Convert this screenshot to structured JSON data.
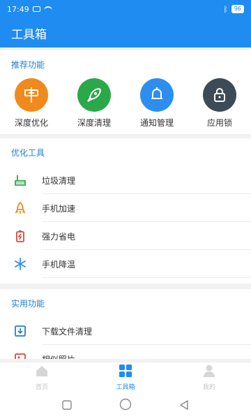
{
  "status": {
    "time": "17:49",
    "battery": "96"
  },
  "appbar": {
    "title": "工具箱"
  },
  "recommend": {
    "title": "推荐功能",
    "items": [
      {
        "label": "深度优化",
        "icon": "signpost-icon",
        "color": "#f08a1c"
      },
      {
        "label": "深度清理",
        "icon": "rocket-icon",
        "color": "#2ba84a"
      },
      {
        "label": "通知管理",
        "icon": "bell-icon",
        "color": "#2d8ef0"
      },
      {
        "label": "应用锁",
        "icon": "lock-icon",
        "color": "#3d4a57"
      }
    ]
  },
  "optimize": {
    "title": "优化工具",
    "items": [
      {
        "label": "垃圾清理",
        "icon": "broom-icon"
      },
      {
        "label": "手机加速",
        "icon": "rocket-icon"
      },
      {
        "label": "强力省电",
        "icon": "battery-icon"
      },
      {
        "label": "手机降温",
        "icon": "snowflake-icon"
      }
    ]
  },
  "utility": {
    "title": "实用功能",
    "items": [
      {
        "label": "下载文件清理",
        "icon": "download-icon"
      },
      {
        "label": "相似照片",
        "icon": "photo-icon"
      }
    ]
  },
  "tabbar": {
    "items": [
      {
        "label": "首页",
        "icon": "home-icon"
      },
      {
        "label": "工具箱",
        "icon": "grid-icon"
      },
      {
        "label": "我的",
        "icon": "person-icon"
      }
    ],
    "active_index": 1
  }
}
